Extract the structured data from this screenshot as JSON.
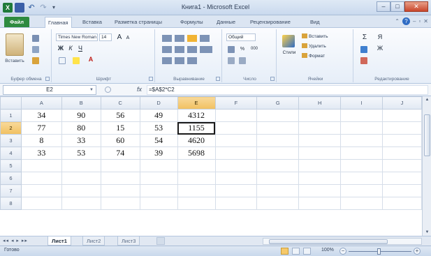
{
  "window": {
    "title": "Книга1 - Microsoft Excel",
    "buttons": {
      "minimize": "–",
      "maximize": "□",
      "close": "✕"
    },
    "qat": {
      "excel_icon_letter": "X",
      "undo": "↶",
      "redo": "↷",
      "more": "▾"
    }
  },
  "tabs": [
    {
      "label": "Файл"
    },
    {
      "label": "Главная"
    },
    {
      "label": "Вставка"
    },
    {
      "label": "Разметка страницы"
    },
    {
      "label": "Формулы"
    },
    {
      "label": "Данные"
    },
    {
      "label": "Рецензирование"
    },
    {
      "label": "Вид"
    }
  ],
  "ribbon": {
    "clipboard": {
      "label": "Буфер обмена",
      "paste": "Вставить"
    },
    "font": {
      "label": "Шрифт",
      "name": "Times New Roman",
      "size": "14",
      "bold": "Ж",
      "italic": "К",
      "underline": "Ч",
      "grow": "A",
      "shrink": "A",
      "font_color": "A"
    },
    "alignment": {
      "label": "Выравнивание"
    },
    "number": {
      "label": "Число",
      "format": "Общий",
      "percent": "%",
      "thousands": "000"
    },
    "styles": {
      "label": "Стили",
      "button": "Стили"
    },
    "cells": {
      "label": "Ячейки",
      "insert": "Вставить",
      "delete": "Удалить",
      "format": "Формат"
    },
    "editing": {
      "label": "Редактирование",
      "sum": "Σ",
      "sort": "Я",
      "find": "Ж"
    }
  },
  "formula_bar": {
    "cell_ref": "E2",
    "fx": "fx",
    "formula": "=$A$2*C2"
  },
  "grid": {
    "columns": [
      "A",
      "B",
      "C",
      "D",
      "E",
      "F",
      "G",
      "H",
      "I",
      "J"
    ],
    "selected_column": "E",
    "selected_row": "2",
    "rows": [
      {
        "n": "1",
        "cells": [
          "34",
          "90",
          "56",
          "49",
          "4312",
          "",
          "",
          "",
          "",
          ""
        ]
      },
      {
        "n": "2",
        "cells": [
          "77",
          "80",
          "15",
          "53",
          "1155",
          "",
          "",
          "",
          "",
          ""
        ]
      },
      {
        "n": "3",
        "cells": [
          "8",
          "33",
          "60",
          "54",
          "4620",
          "",
          "",
          "",
          "",
          ""
        ]
      },
      {
        "n": "4",
        "cells": [
          "33",
          "53",
          "74",
          "39",
          "5698",
          "",
          "",
          "",
          "",
          ""
        ]
      },
      {
        "n": "5",
        "cells": [
          "",
          "",
          "",
          "",
          "",
          "",
          "",
          "",
          "",
          ""
        ]
      },
      {
        "n": "6",
        "cells": [
          "",
          "",
          "",
          "",
          "",
          "",
          "",
          "",
          "",
          ""
        ]
      },
      {
        "n": "7",
        "cells": [
          "",
          "",
          "",
          "",
          "",
          "",
          "",
          "",
          "",
          ""
        ]
      },
      {
        "n": "8",
        "cells": [
          "",
          "",
          "",
          "",
          "",
          "",
          "",
          "",
          "",
          ""
        ]
      }
    ]
  },
  "sheets": {
    "nav": "◂◂ ◂ ▸ ▸▸",
    "tabs": [
      {
        "label": "Лист1",
        "active": true
      },
      {
        "label": "Лист2",
        "active": false
      },
      {
        "label": "Лист3",
        "active": false
      }
    ]
  },
  "status": {
    "text": "Готово",
    "zoom": "100%"
  },
  "colors": {
    "file_tab": "#2e8b3f",
    "selection_header": "#f1c060",
    "active_cell_border": "#1a1a1a"
  }
}
